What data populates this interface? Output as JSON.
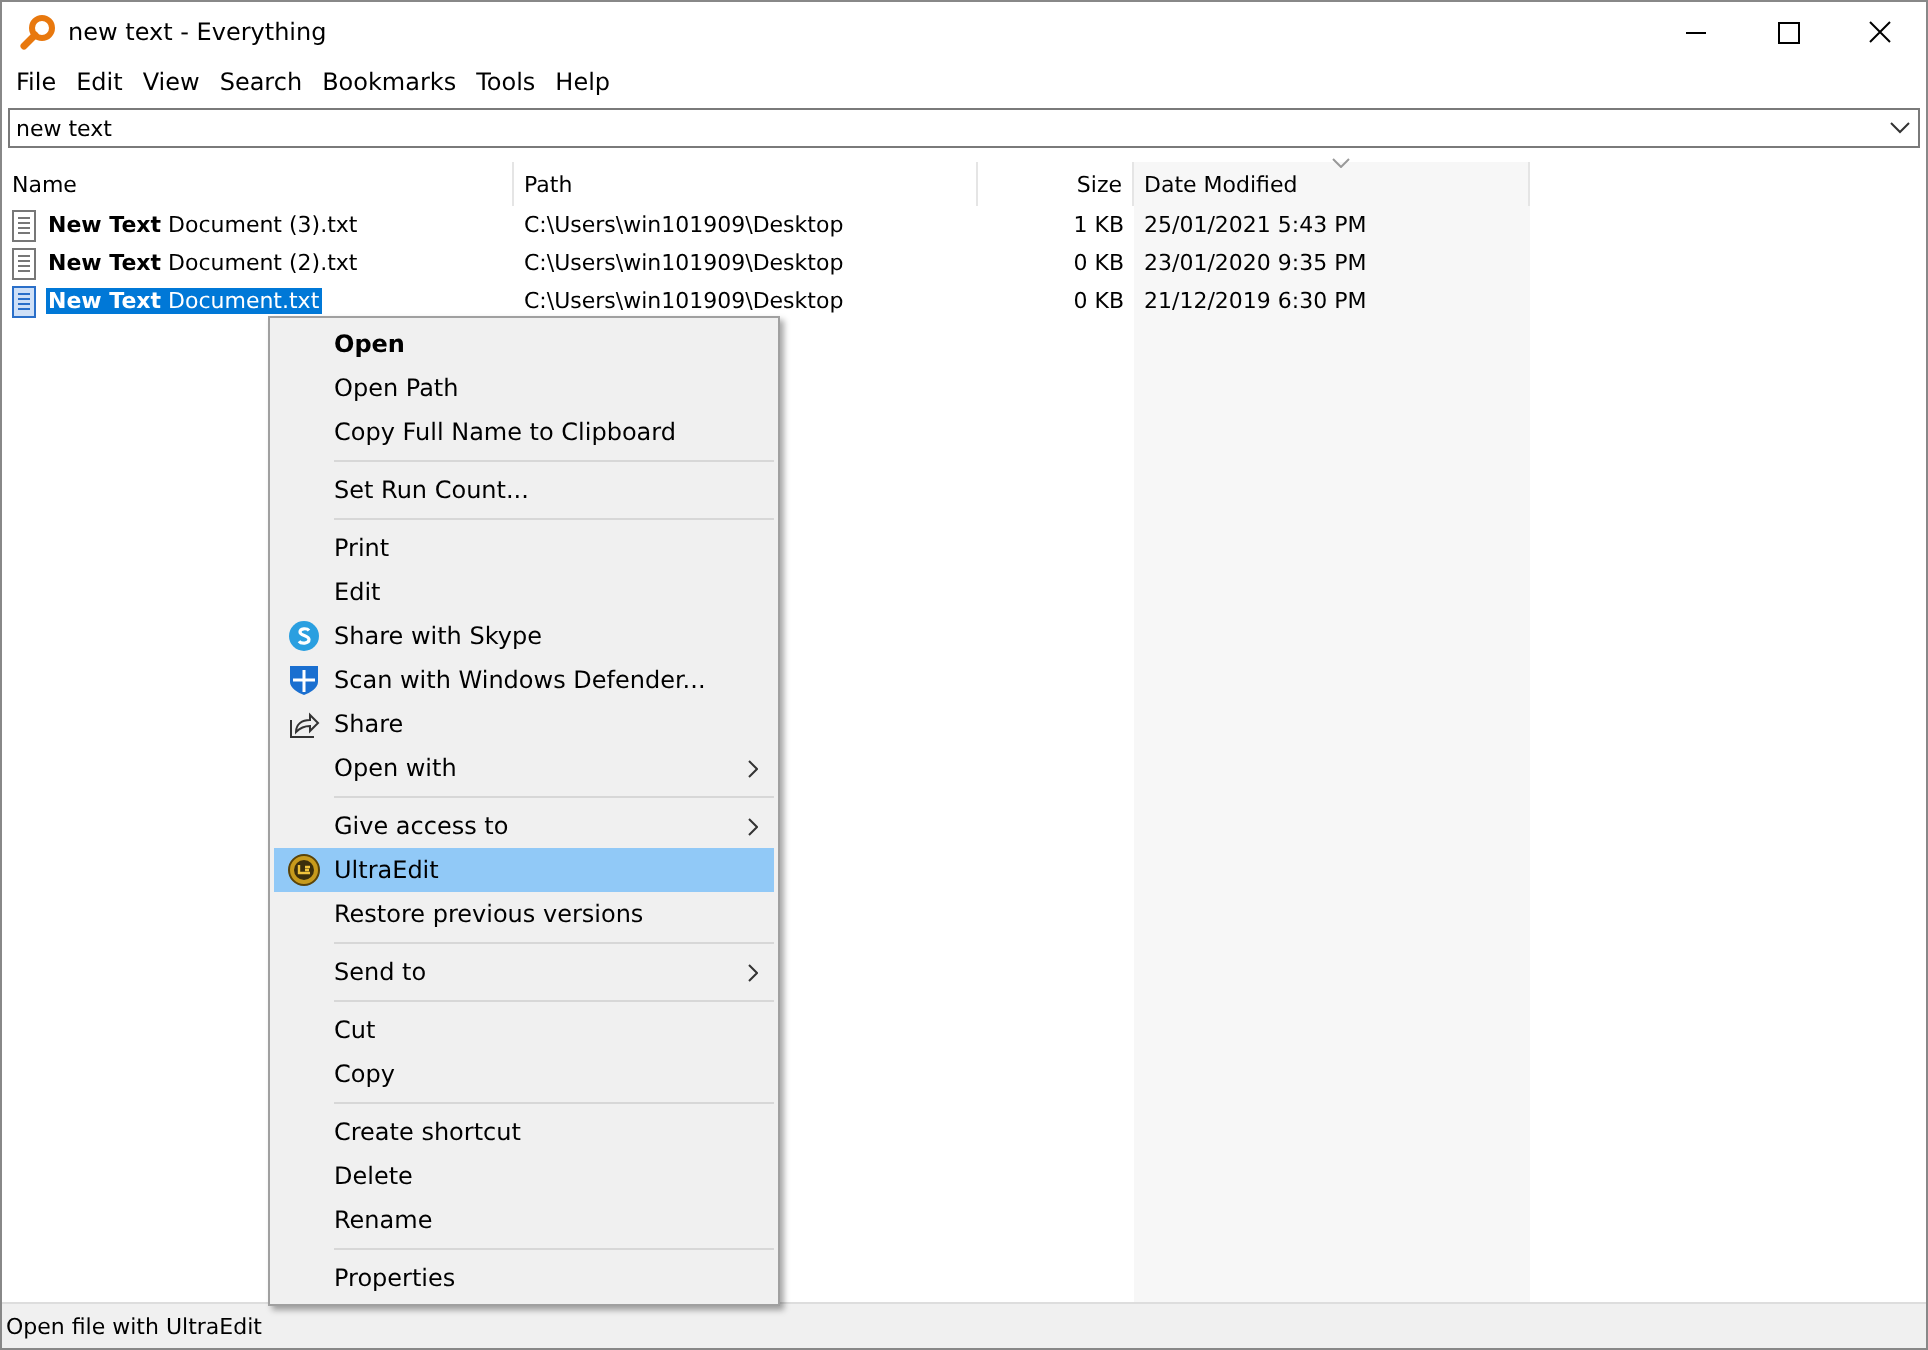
{
  "window": {
    "title": "new text - Everything"
  },
  "menubar": [
    "File",
    "Edit",
    "View",
    "Search",
    "Bookmarks",
    "Tools",
    "Help"
  ],
  "search": {
    "value": "new text"
  },
  "table": {
    "columns": [
      {
        "label": "Name",
        "sorted": false
      },
      {
        "label": "Path",
        "sorted": false
      },
      {
        "label": "Size",
        "sorted": false
      },
      {
        "label": "Date Modified",
        "sorted": true
      }
    ],
    "rows": [
      {
        "name": "**New Text** Document (3).txt",
        "path": "C:\\Users\\win101909\\Desktop",
        "size": "1 KB",
        "date": "25/01/2021 5:43 PM",
        "selected": false
      },
      {
        "name": "**New Text** Document (2).txt",
        "path": "C:\\Users\\win101909\\Desktop",
        "size": "0 KB",
        "date": "23/01/2020 9:35 PM",
        "selected": false
      },
      {
        "name": "**New Text** Document.txt",
        "path": "C:\\Users\\win101909\\Desktop",
        "size": "0 KB",
        "date": "21/12/2019 6:30 PM",
        "selected": true
      }
    ]
  },
  "context_menu": [
    {
      "kind": "default",
      "label": "Open",
      "selected": false
    },
    {
      "kind": "item",
      "label": "Open Path",
      "selected": false
    },
    {
      "kind": "item",
      "label": "Copy Full Name to Clipboard",
      "selected": false
    },
    {
      "kind": "separator"
    },
    {
      "kind": "item",
      "label": "Set Run Count...",
      "selected": false
    },
    {
      "kind": "separator"
    },
    {
      "kind": "item",
      "label": "Print",
      "selected": false
    },
    {
      "kind": "item",
      "label": "Edit",
      "selected": false
    },
    {
      "kind": "skype",
      "label": "Share with Skype",
      "selected": false
    },
    {
      "kind": "defender",
      "label": "Scan with Windows Defender...",
      "selected": false
    },
    {
      "kind": "share",
      "label": "Share",
      "selected": false
    },
    {
      "kind": "submenu",
      "label": "Open with",
      "selected": false
    },
    {
      "kind": "separator"
    },
    {
      "kind": "submenu",
      "label": "Give access to",
      "selected": false
    },
    {
      "kind": "ultraedit",
      "label": "UltraEdit",
      "selected": true
    },
    {
      "kind": "item",
      "label": "Restore previous versions",
      "selected": false
    },
    {
      "kind": "separator"
    },
    {
      "kind": "submenu",
      "label": "Send to",
      "selected": false
    },
    {
      "kind": "separator"
    },
    {
      "kind": "item",
      "label": "Cut",
      "selected": false
    },
    {
      "kind": "item",
      "label": "Copy",
      "selected": false
    },
    {
      "kind": "separator"
    },
    {
      "kind": "item",
      "label": "Create shortcut",
      "selected": false
    },
    {
      "kind": "item",
      "label": "Delete",
      "selected": false
    },
    {
      "kind": "item",
      "label": "Rename",
      "selected": false
    },
    {
      "kind": "separator"
    },
    {
      "kind": "item",
      "label": "Properties",
      "selected": false
    }
  ],
  "status_bar": {
    "text": "Open file with UltraEdit"
  }
}
